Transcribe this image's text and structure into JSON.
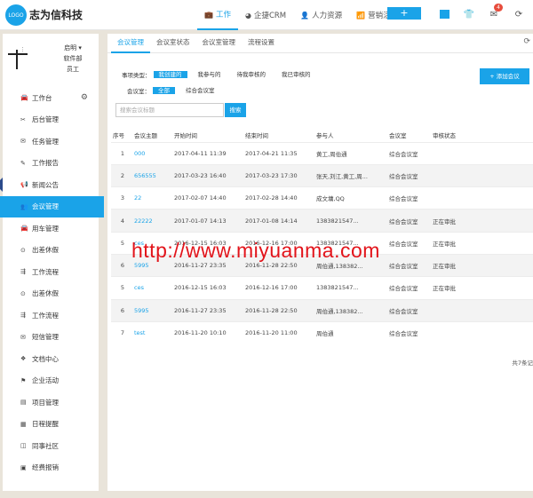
{
  "app": {
    "logo_text": "LOGO",
    "brand": "志为信科技"
  },
  "topnav": [
    {
      "icon": "briefcase-icon",
      "glyph": "💼",
      "label": "工作",
      "active": true
    },
    {
      "icon": "pie-chart-icon",
      "glyph": "◕",
      "label": "企捷CRM",
      "active": false
    },
    {
      "icon": "user-icon",
      "glyph": "👤",
      "label": "人力资源",
      "active": false
    },
    {
      "icon": "marketing-icon",
      "glyph": "📶",
      "label": "营销活动",
      "active": false
    }
  ],
  "topbar": {
    "plus_label": "+",
    "mail_badge": "4"
  },
  "profile": {
    "name": "启明 ▾",
    "dept": "软件部",
    "role": "员工"
  },
  "sidebar": {
    "items": [
      {
        "icon": "car-icon",
        "glyph": "🚘",
        "label": "工作台"
      },
      {
        "icon": "wrench-icon",
        "glyph": "✂",
        "label": "后台管理"
      },
      {
        "icon": "task-icon",
        "glyph": "✉",
        "label": "任务管理"
      },
      {
        "icon": "report-icon",
        "glyph": "✎",
        "label": "工作报告"
      },
      {
        "icon": "announce-icon",
        "glyph": "📢",
        "label": "新闻公告"
      },
      {
        "icon": "meeting-icon",
        "glyph": "👥",
        "label": "会议管理"
      },
      {
        "icon": "car-icon",
        "glyph": "🚘",
        "label": "用车管理"
      },
      {
        "icon": "location-icon",
        "glyph": "⊙",
        "label": "出差休假"
      },
      {
        "icon": "flow-icon",
        "glyph": "⇶",
        "label": "工作流程"
      },
      {
        "icon": "location-icon",
        "glyph": "⊙",
        "label": "出差休假"
      },
      {
        "icon": "flow-icon",
        "glyph": "⇶",
        "label": "工作流程"
      },
      {
        "icon": "sms-icon",
        "glyph": "✉",
        "label": "短信管理"
      },
      {
        "icon": "docs-icon",
        "glyph": "❖",
        "label": "文档中心"
      },
      {
        "icon": "flag-icon",
        "glyph": "⚑",
        "label": "企业活动"
      },
      {
        "icon": "project-icon",
        "glyph": "▤",
        "label": "项目管理"
      },
      {
        "icon": "calendar-icon",
        "glyph": "▦",
        "label": "日程提醒"
      },
      {
        "icon": "community-icon",
        "glyph": "◫",
        "label": "同事社区"
      },
      {
        "icon": "expense-icon",
        "glyph": "▣",
        "label": "经费报销"
      }
    ]
  },
  "tabs": [
    "会议管理",
    "会议室状态",
    "会议室管理",
    "流程设置"
  ],
  "filters": {
    "type_label": "事项类型：",
    "type_options": [
      "我创建的",
      "我参与的",
      "待我审核的",
      "我已审核的"
    ],
    "room_label": "会议室：",
    "room_options": [
      "全部",
      "综合会议室"
    ]
  },
  "add_button": "+ 添加会议",
  "search": {
    "placeholder": "搜索会议标题",
    "button": "搜索"
  },
  "table": {
    "headers": [
      "序号",
      "会议主题",
      "开始时间",
      "结束时间",
      "参与人",
      "会议室",
      "审核状态"
    ],
    "rows": [
      {
        "no": "1",
        "topic": "000",
        "start": "2017-04-11 11:39",
        "end": "2017-04-21 11:35",
        "attendees": "黄工,周伯通",
        "room": "综合会议室",
        "status": ""
      },
      {
        "no": "2",
        "topic": "656555",
        "start": "2017-03-23 16:40",
        "end": "2017-03-23 17:30",
        "attendees": "张天,刘江,黄工,周...",
        "room": "综合会议室",
        "status": ""
      },
      {
        "no": "3",
        "topic": "22",
        "start": "2017-02-07 14:40",
        "end": "2017-02-28 14:40",
        "attendees": "成文墉,QQ",
        "room": "综合会议室",
        "status": ""
      },
      {
        "no": "4",
        "topic": "22222",
        "start": "2017-01-07 14:13",
        "end": "2017-01-08 14:14",
        "attendees": "1383821547...",
        "room": "综合会议室",
        "status": "正在审批"
      },
      {
        "no": "5",
        "topic": "ces",
        "start": "2016-12-15 16:03",
        "end": "2016-12-16 17:00",
        "attendees": "1383821547...",
        "room": "综合会议室",
        "status": "正在审批"
      },
      {
        "no": "6",
        "topic": "5995",
        "start": "2016-11-27 23:35",
        "end": "2016-11-28 22:50",
        "attendees": "周伯通,138382...",
        "room": "综合会议室",
        "status": "正在审批"
      },
      {
        "no": "5",
        "topic": "ces",
        "start": "2016-12-15 16:03",
        "end": "2016-12-16 17:00",
        "attendees": "1383821547...",
        "room": "综合会议室",
        "status": "正在审批"
      },
      {
        "no": "6",
        "topic": "5995",
        "start": "2016-11-27 23:35",
        "end": "2016-11-28 22:50",
        "attendees": "周伯通,138382...",
        "room": "综合会议室",
        "status": ""
      },
      {
        "no": "7",
        "topic": "test",
        "start": "2016-11-20 10:10",
        "end": "2016-11-20 11:00",
        "attendees": "周伯通",
        "room": "综合会议室",
        "status": ""
      }
    ],
    "total": "共7条记"
  },
  "watermark": "http://www.miyuanma.com",
  "colors": {
    "accent": "#1aa3e8",
    "watermark": "#e2141b",
    "badge": "#e74c3c"
  }
}
